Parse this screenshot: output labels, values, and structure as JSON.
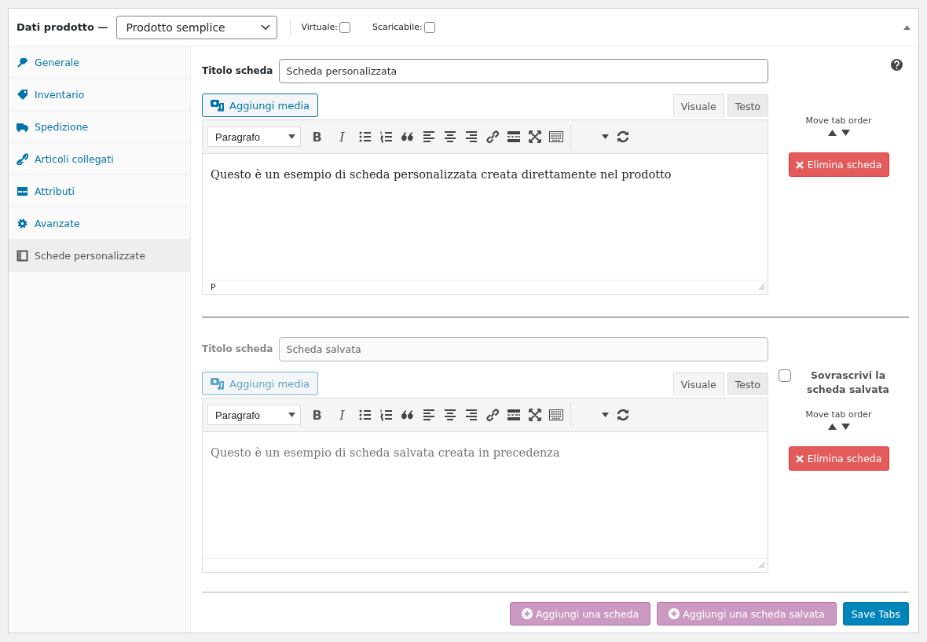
{
  "header": {
    "title": "Dati prodotto —",
    "product_type": "Prodotto semplice",
    "options": [
      {
        "label": "Virtuale:",
        "checked": false
      },
      {
        "label": "Scaricabile:",
        "checked": false
      }
    ]
  },
  "sidebar": {
    "items": [
      {
        "label": "Generale",
        "selected": false
      },
      {
        "label": "Inventario",
        "selected": false
      },
      {
        "label": "Spedizione",
        "selected": false
      },
      {
        "label": "Articoli collegati",
        "selected": false
      },
      {
        "label": "Attributi",
        "selected": false
      },
      {
        "label": "Avanzate",
        "selected": false
      },
      {
        "label": "Schede personalizzate",
        "selected": true
      }
    ]
  },
  "tab_blocks": [
    {
      "disabled": false,
      "title_label": "Titolo scheda",
      "title_value": "Scheda personalizzata",
      "media_button": "Aggiungi media",
      "editor_tabs": [
        {
          "label": "Visuale",
          "selected": true
        },
        {
          "label": "Testo",
          "selected": false
        }
      ],
      "format": "Paragrafo",
      "bold": "B",
      "italic": "I",
      "content": "Questo è un esempio di scheda personalizzata creata direttamente nel prodotto",
      "path": "P",
      "move_label": "Move tab order",
      "delete_button": "Elimina scheda"
    },
    {
      "disabled": true,
      "title_label": "Titolo scheda",
      "title_value": "Scheda salvata",
      "media_button": "Aggiungi media",
      "editor_tabs": [
        {
          "label": "Visuale",
          "selected": true
        },
        {
          "label": "Testo",
          "selected": false
        }
      ],
      "format": "Paragrafo",
      "bold": "B",
      "italic": "I",
      "content": "Questo è un esempio di scheda salvata creata in precedenza",
      "overwrite": {
        "label": "Sovrascrivi la scheda salvata",
        "checked": false
      },
      "move_label": "Move tab order",
      "delete_button": "Elimina scheda"
    }
  ],
  "footer_buttons": [
    {
      "label": "Aggiungi una scheda",
      "kind": "add"
    },
    {
      "label": "Aggiungi una scheda salvata",
      "kind": "add"
    },
    {
      "label": "Save Tabs",
      "kind": "primary"
    }
  ]
}
